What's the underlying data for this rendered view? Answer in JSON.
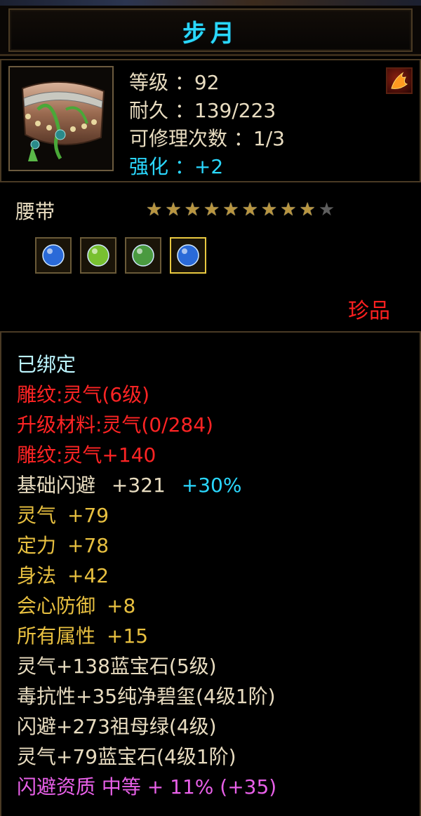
{
  "title": "步月",
  "item": {
    "level": "等级 ：92",
    "durability": "耐久 ：139/223",
    "repairs": "可修理次数 ：1/3",
    "enhance": "强化 ：+2",
    "type": "腰带",
    "stars_filled": 9,
    "stars_total": 10,
    "rarity": "珍品"
  },
  "gems": [
    {
      "name": "blue-sapphire-gem-icon",
      "color": "#2a6ad8",
      "selected": false
    },
    {
      "name": "green-crystal-gem-icon",
      "color": "#78c030",
      "selected": false
    },
    {
      "name": "jade-ring-gem-icon",
      "color": "#4a9a40",
      "selected": false
    },
    {
      "name": "blue-sapphire-gem-icon",
      "color": "#2a6ad8",
      "selected": true
    }
  ],
  "details": {
    "bound": "已绑定",
    "engrave": "雕纹:灵气(6级)",
    "upgrade": "升级材料:灵气(0/284)",
    "engrave_bonus": "雕纹:灵气+140",
    "dodge_label": "基础闪避",
    "dodge_value": "+321",
    "dodge_pct": "+30%",
    "attrs": [
      {
        "label": "灵气",
        "value": "+79"
      },
      {
        "label": "定力",
        "value": "+78"
      },
      {
        "label": "身法",
        "value": "+42"
      },
      {
        "label": "会心防御",
        "value": "+8"
      },
      {
        "label": "所有属性",
        "value": "+15"
      }
    ],
    "gem_lines": [
      "灵气+138蓝宝石(5级)",
      "毒抗性+35纯净碧玺(4级1阶)",
      "闪避+273祖母绿(4级)",
      "灵气+79蓝宝石(4级1阶)"
    ],
    "aptitude": "闪避资质 中等 + 11% (+35)"
  }
}
